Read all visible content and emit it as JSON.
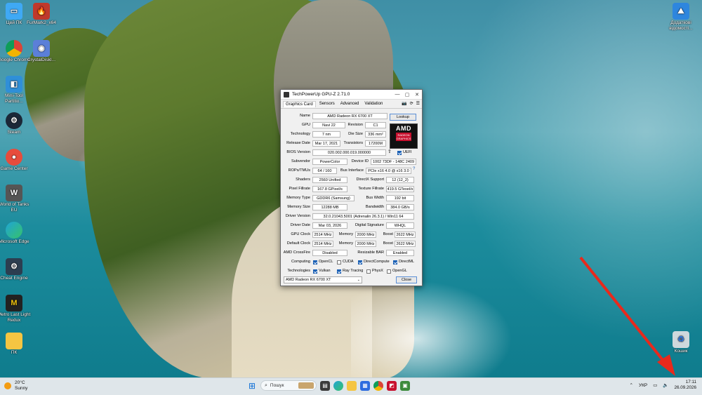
{
  "desktop": {
    "icons_left": [
      {
        "label": "Цей ПК",
        "icon": "this-pc-icon",
        "color": "#3fa9f5"
      },
      {
        "label": "FurMark2_x64",
        "icon": "furmark-icon",
        "color": "#c0392b"
      },
      {
        "label": "Google Chrome",
        "icon": "chrome-icon",
        "color": "#ffffff"
      },
      {
        "label": "CrystalDiskI...",
        "icon": "crystaldisk-icon",
        "color": "#5b7fd8"
      },
      {
        "label": "Mini-Tool Partitio...",
        "icon": "minitool-icon",
        "color": "#2f8fd8"
      },
      {
        "label": "Steam",
        "icon": "steam-icon",
        "color": "#1b2838"
      },
      {
        "label": "Game Center",
        "icon": "game-center-icon",
        "color": "#e74c3c"
      },
      {
        "label": "World of Tanks EU",
        "icon": "wot-icon",
        "color": "#555555"
      },
      {
        "label": "Microsoft Edge",
        "icon": "edge-icon",
        "color": "#1fa4d6"
      },
      {
        "label": "Cheat Engine",
        "icon": "cheat-engine-icon",
        "color": "#2c3e50"
      },
      {
        "label": "Metro Last Light Redux",
        "icon": "metro-icon",
        "color": "#222222"
      },
      {
        "label": "ПК",
        "icon": "folder-icon",
        "color": "#f5c542"
      }
    ],
    "icons_right": [
      {
        "label": "Додаткові відомості...",
        "icon": "spotlight-icon",
        "color": "#2e86de"
      },
      {
        "label": "Кошик",
        "icon": "recycle-bin-icon",
        "color": "#cfd8dc"
      }
    ]
  },
  "gpuz": {
    "title": "TechPowerUp GPU-Z 2.71.0",
    "tabs": [
      "Graphics Card",
      "Sensors",
      "Advanced",
      "Validation"
    ],
    "lookup_label": "Lookup",
    "logo_text": "AMD",
    "logo_sub": "RADEON GRAPHICS",
    "name_label": "Name",
    "name": "AMD Radeon RX 6700 XT",
    "gpu_label": "GPU",
    "gpu": "Navi 22",
    "revision_label": "Revision",
    "revision": "C1",
    "technology_label": "Technology",
    "technology": "7 nm",
    "diesize_label": "Die Size",
    "diesize": "336 mm²",
    "release_label": "Release Date",
    "release": "Mar 17, 2021",
    "transistors_label": "Transistors",
    "transistors": "17200M",
    "bios_label": "BIOS Version",
    "bios": "020.002.000.019.000000",
    "uefi_label": "UEFI",
    "subvendor_label": "Subvendor",
    "subvendor": "PowerColor",
    "deviceid_label": "Device ID",
    "deviceid": "1002 73DF - 148C 2409",
    "rops_label": "ROPs/TMUs",
    "rops": "64 / 160",
    "businterface_label": "Bus Interface",
    "businterface": "PCIe x16 4.0 @ x16 3.0",
    "shaders_label": "Shaders",
    "shaders": "2560 Unified",
    "directx_label": "DirectX Support",
    "directx": "12 (12_2)",
    "pixelfill_label": "Pixel Fillrate",
    "pixelfill": "167.8 GPixel/s",
    "texturefill_label": "Texture Fillrate",
    "texturefill": "419.5 GTexel/s",
    "memtype_label": "Memory Type",
    "memtype": "GDDR6 (Samsung)",
    "buswidth_label": "Bus Width",
    "buswidth": "192 bit",
    "memsize_label": "Memory Size",
    "memsize": "12288 MB",
    "bandwidth_label": "Bandwidth",
    "bandwidth": "384.0 GB/s",
    "driverver_label": "Driver Version",
    "driverver": "32.0.21043.5001 (Adrenalin 26.3.1) / Win11 64",
    "driverdate_label": "Driver Date",
    "driverdate": "Mar 03, 2026",
    "digsig_label": "Digital Signature",
    "digsig": "WHQL",
    "gpuclock_label": "GPU Clock",
    "gpuclock": "2514 MHz",
    "memory_label": "Memory",
    "memclock": "2000 MHz",
    "boost_label": "Boost",
    "boost": "2622 MHz",
    "defclock_label": "Default Clock",
    "defclock": "2514 MHz",
    "defmem": "2000 MHz",
    "defboost": "2622 MHz",
    "crossfire_label": "AMD CrossFire",
    "crossfire": "Disabled",
    "resizebar_label": "Resizable BAR",
    "resizebar": "Enabled",
    "computing_label": "Computing",
    "computing": [
      {
        "label": "OpenCL",
        "checked": true
      },
      {
        "label": "CUDA",
        "checked": false
      },
      {
        "label": "DirectCompute",
        "checked": true
      },
      {
        "label": "DirectML",
        "checked": true
      }
    ],
    "technologies_label": "Technologies",
    "technologies": [
      {
        "label": "Vulkan",
        "checked": true
      },
      {
        "label": "Ray Tracing",
        "checked": true
      },
      {
        "label": "PhysX",
        "checked": false
      },
      {
        "label": "OpenGL",
        "checked": false
      }
    ],
    "selected_card": "AMD Radeon RX 6700 XT",
    "close_label": "Close"
  },
  "taskbar": {
    "weather_temp": "20°C",
    "weather_desc": "Sunny",
    "search_placeholder": "Пошук",
    "language": "УКР",
    "time": "17:11",
    "date": "26.09.2026"
  },
  "colors": {
    "accent": "#1a5fb4",
    "annotation_arrow": "#e8291c",
    "taskbar_bg": "#dfe6ea"
  }
}
